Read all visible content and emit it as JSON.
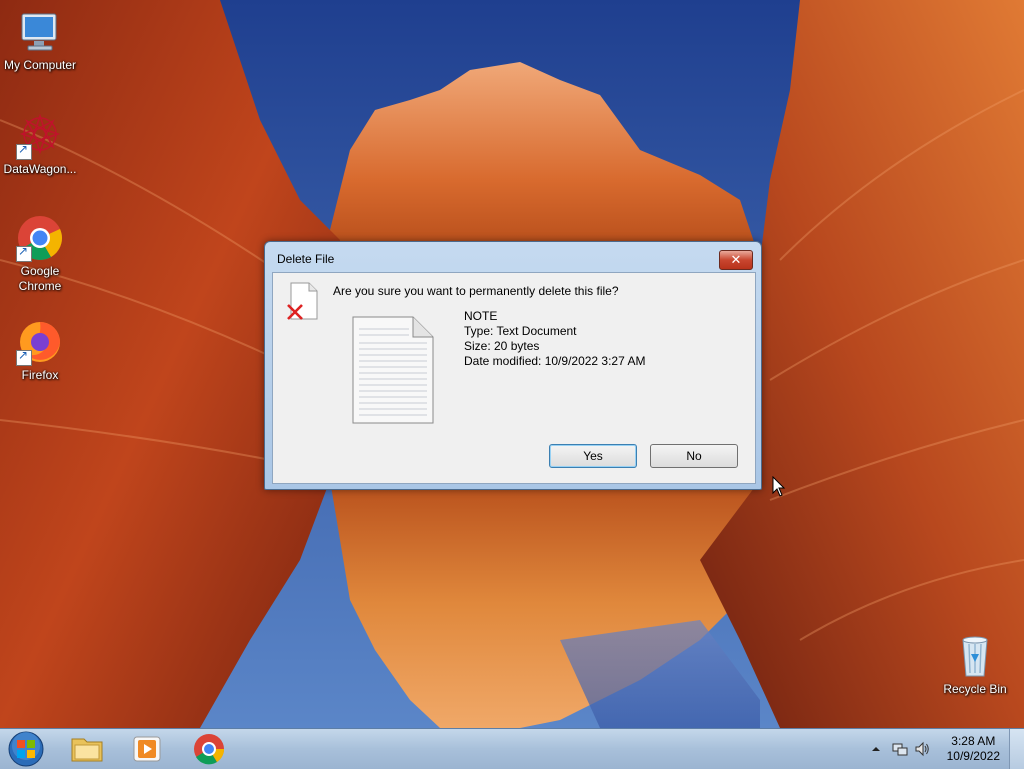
{
  "desktop": {
    "icons": [
      {
        "label": "My Computer",
        "icon": "my-computer-icon"
      },
      {
        "label": "DataWagon...",
        "icon": "datawagon-icon"
      },
      {
        "label": "Google Chrome",
        "icon": "chrome-icon"
      },
      {
        "label": "Firefox",
        "icon": "firefox-icon"
      },
      {
        "label": "Recycle Bin",
        "icon": "recycle-bin-icon"
      }
    ]
  },
  "dialog": {
    "title": "Delete File",
    "question": "Are you sure you want to permanently delete this file?",
    "file_name": "NOTE",
    "file_type": "Type: Text Document",
    "file_size": "Size: 20 bytes",
    "date_modified": "Date modified: 10/9/2022 3:27 AM",
    "yes_label": "Yes",
    "no_label": "No",
    "close_label": "✕"
  },
  "taskbar": {
    "pinned": [
      "file-explorer-icon",
      "media-player-icon",
      "chrome-icon"
    ],
    "clock_time": "3:28 AM",
    "clock_date": "10/9/2022",
    "tray_icons": [
      "show-hidden-icons",
      "network-icon",
      "volume-icon"
    ]
  },
  "colors": {
    "taskbar": "#b3c8df",
    "dialog_frame": "#b8d1eb",
    "close_button": "#c9462f",
    "default_button_border": "#3c7fb1"
  }
}
